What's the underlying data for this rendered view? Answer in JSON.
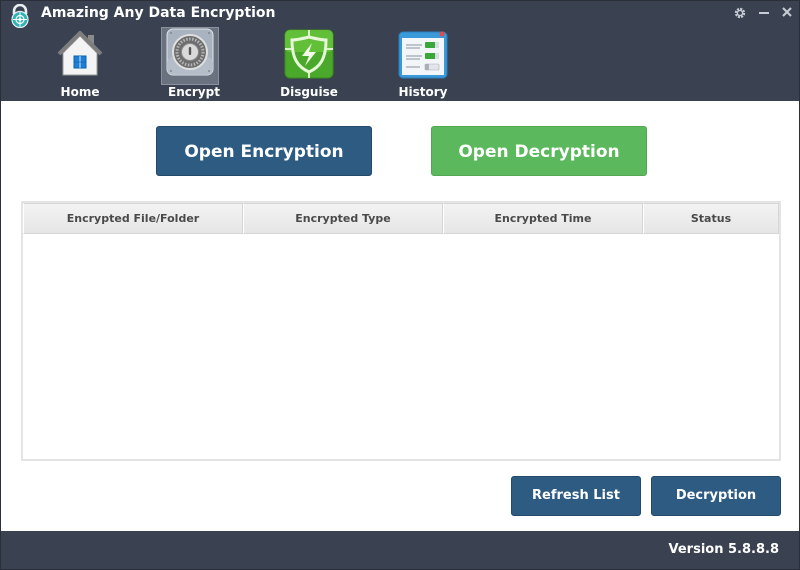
{
  "window": {
    "title": "Amazing Any Data Encryption",
    "controls": {
      "settings_icon": "gear-icon",
      "minimize_glyph": "—",
      "close_glyph": "✕"
    }
  },
  "nav": {
    "active": "Encrypt",
    "items": [
      {
        "label": "Home",
        "icon": "house-icon"
      },
      {
        "label": "Encrypt",
        "icon": "safe-lock-icon"
      },
      {
        "label": "Disguise",
        "icon": "shield-lightning-icon"
      },
      {
        "label": "History",
        "icon": "history-list-icon"
      }
    ]
  },
  "actions": {
    "open_encryption": "Open Encryption",
    "open_decryption": "Open Decryption"
  },
  "table": {
    "columns": [
      "Encrypted File/Folder",
      "Encrypted Type",
      "Encrypted Time",
      "Status"
    ],
    "rows": []
  },
  "bottom_buttons": {
    "refresh": "Refresh List",
    "decryption": "Decryption"
  },
  "footer": {
    "version": "Version 5.8.8.8"
  },
  "colors": {
    "header_bg": "#3a4251",
    "primary_blue": "#2d5b82",
    "success_green": "#5cb85c"
  }
}
